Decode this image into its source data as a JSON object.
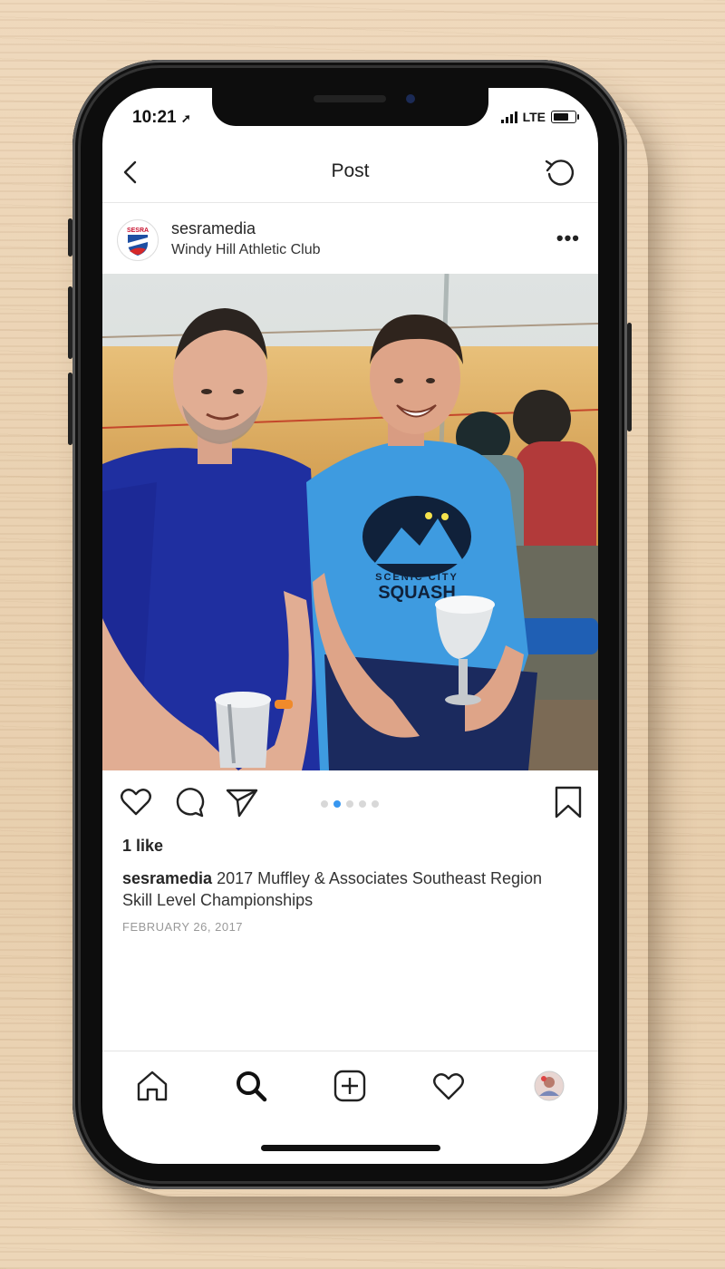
{
  "status_bar": {
    "time": "10:21",
    "network": "LTE"
  },
  "navbar": {
    "title": "Post"
  },
  "post": {
    "username": "sesramedia",
    "location": "Windy Hill Athletic Club",
    "avatar_text": "SESRA",
    "more_label": "•••",
    "carousel": {
      "total": 5,
      "active_index": 1
    },
    "likes": "1 like",
    "caption_user": "sesramedia",
    "caption_text": "2017 Muffley & Associates Southeast Region Skill Level Championships",
    "date": "FEBRUARY 26, 2017"
  },
  "photo_shirt_text": {
    "line1": "SCENIC CITY",
    "line2": "SQUASH"
  },
  "icons": {
    "back": "chevron-left-icon",
    "refresh": "refresh-icon",
    "like": "heart-icon",
    "comment": "comment-icon",
    "share": "paper-plane-icon",
    "save": "bookmark-icon",
    "tabs": [
      "home-icon",
      "search-icon",
      "add-post-icon",
      "activity-heart-icon",
      "profile-avatar-icon"
    ]
  },
  "colors": {
    "accent": "#3897f0",
    "text": "#262626",
    "muted": "#999999"
  }
}
